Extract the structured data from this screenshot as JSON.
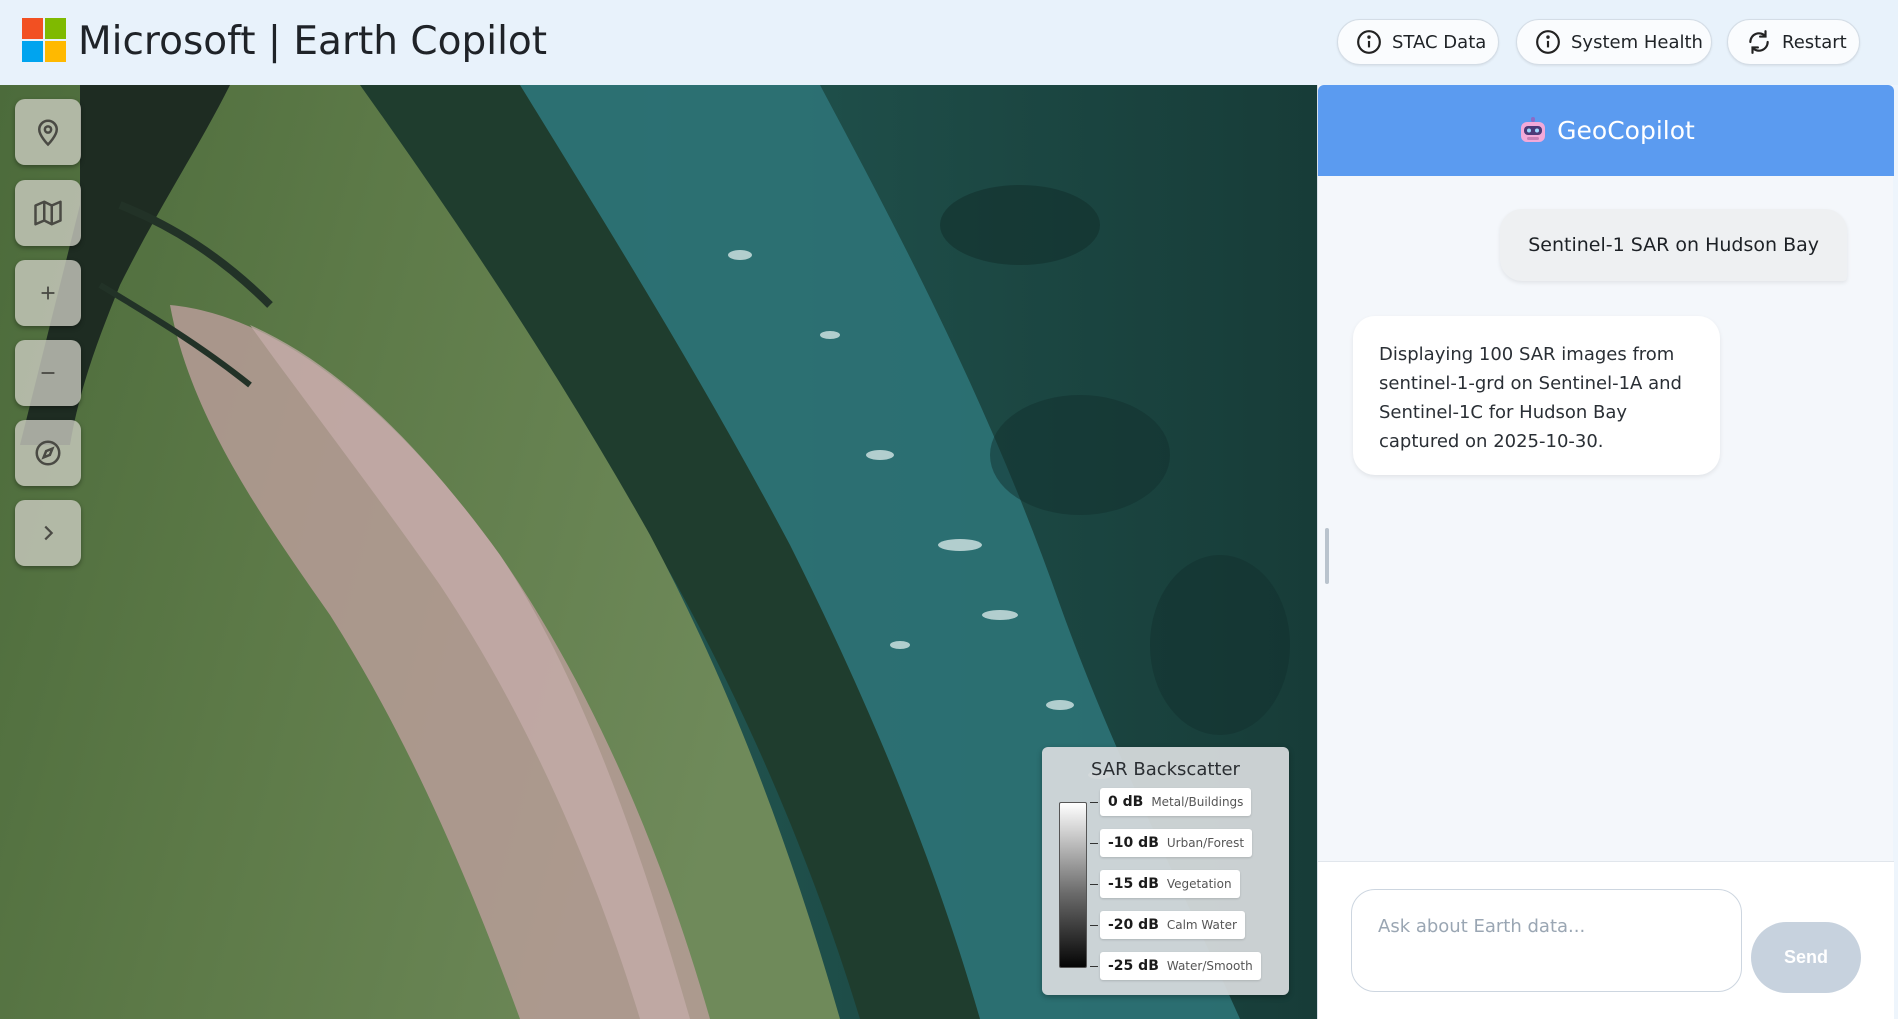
{
  "header": {
    "brand_colors": [
      "#f25022",
      "#7fba00",
      "#00a4ef",
      "#ffb900"
    ],
    "title": "Microsoft | Earth Copilot",
    "buttons": [
      {
        "label": "STAC Data",
        "icon": "info-circle-icon"
      },
      {
        "label": "System Health",
        "icon": "info-circle-icon"
      },
      {
        "label": "Restart",
        "icon": "refresh-icon"
      }
    ]
  },
  "map": {
    "tools": [
      {
        "name": "location",
        "icon": "map-pin-icon"
      },
      {
        "name": "basemap",
        "icon": "map-icon"
      },
      {
        "name": "zoom-in",
        "icon": "plus-icon"
      },
      {
        "name": "zoom-out",
        "icon": "minus-icon"
      },
      {
        "name": "compass",
        "icon": "compass-icon"
      },
      {
        "name": "expand",
        "icon": "chevron-right-icon"
      }
    ],
    "legend": {
      "title": "SAR Backscatter",
      "entries": [
        {
          "db": "0 dB",
          "desc": "Metal/Buildings"
        },
        {
          "db": "-10 dB",
          "desc": "Urban/Forest"
        },
        {
          "db": "-15 dB",
          "desc": "Vegetation"
        },
        {
          "db": "-20 dB",
          "desc": "Calm Water"
        },
        {
          "db": "-25 dB",
          "desc": "Water/Smooth"
        }
      ]
    }
  },
  "chat": {
    "title": "GeoCopilot",
    "header_color": "#5b9bf0",
    "messages": [
      {
        "role": "user",
        "text": "Sentinel-1 SAR on Hudson Bay"
      },
      {
        "role": "assistant",
        "text": "Displaying 100 SAR images from sentinel-1-grd on Sentinel-1A and Sentinel-1C for Hudson Bay captured on 2025-10-30."
      }
    ],
    "input_placeholder": "Ask about Earth data...",
    "input_value": "",
    "send_label": "Send"
  }
}
